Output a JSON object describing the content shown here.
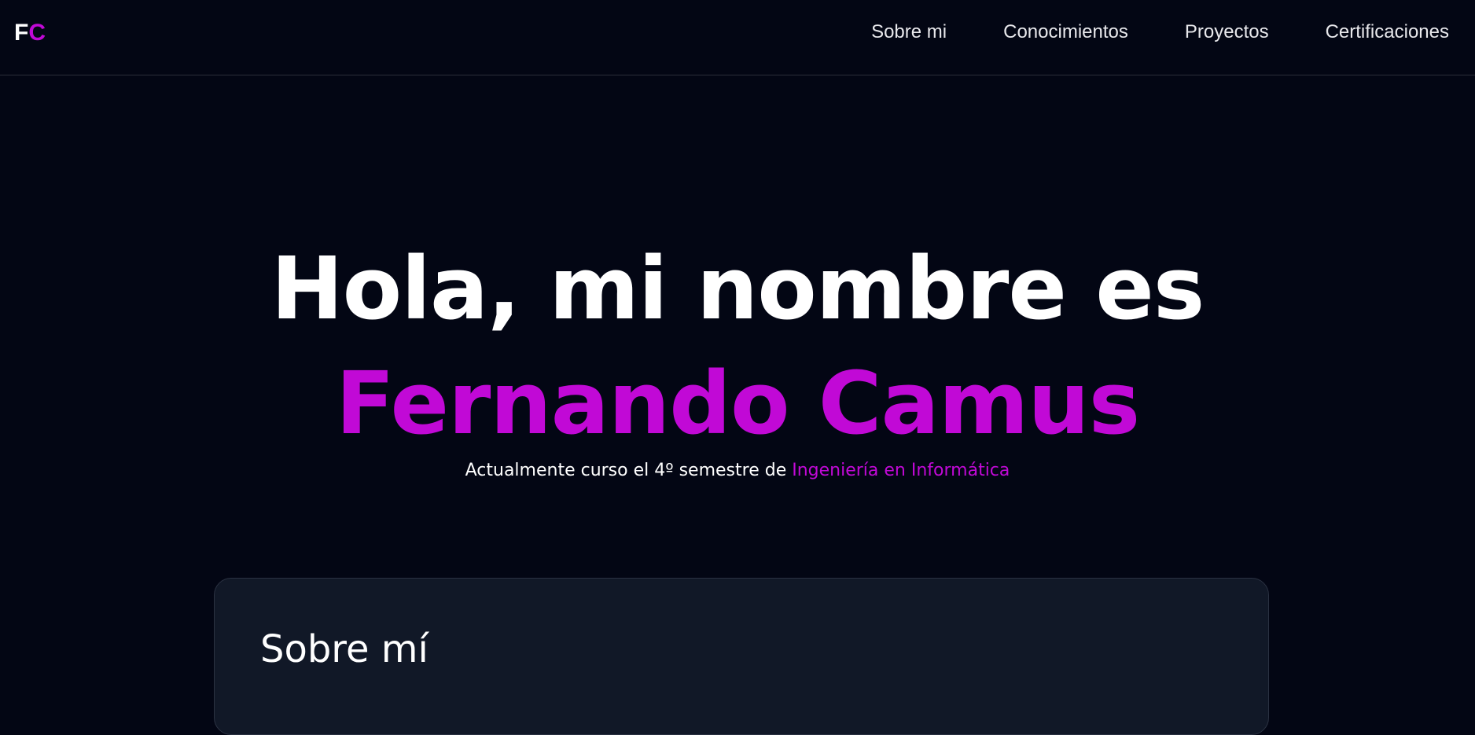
{
  "logo": {
    "first": "F",
    "second": "C"
  },
  "nav": {
    "items": [
      {
        "label": "Sobre mi"
      },
      {
        "label": "Conocimientos"
      },
      {
        "label": "Proyectos"
      },
      {
        "label": "Certificaciones"
      }
    ]
  },
  "hero": {
    "greeting": "Hola, mi nombre es",
    "name": "Fernando Camus",
    "subtitle_prefix": "Actualmente curso el 4º semestre de ",
    "subtitle_highlight": "Ingeniería en Informática"
  },
  "about": {
    "title": "Sobre mí"
  },
  "colors": {
    "background": "#030614",
    "accent": "#c109d6",
    "card": "#111827"
  }
}
